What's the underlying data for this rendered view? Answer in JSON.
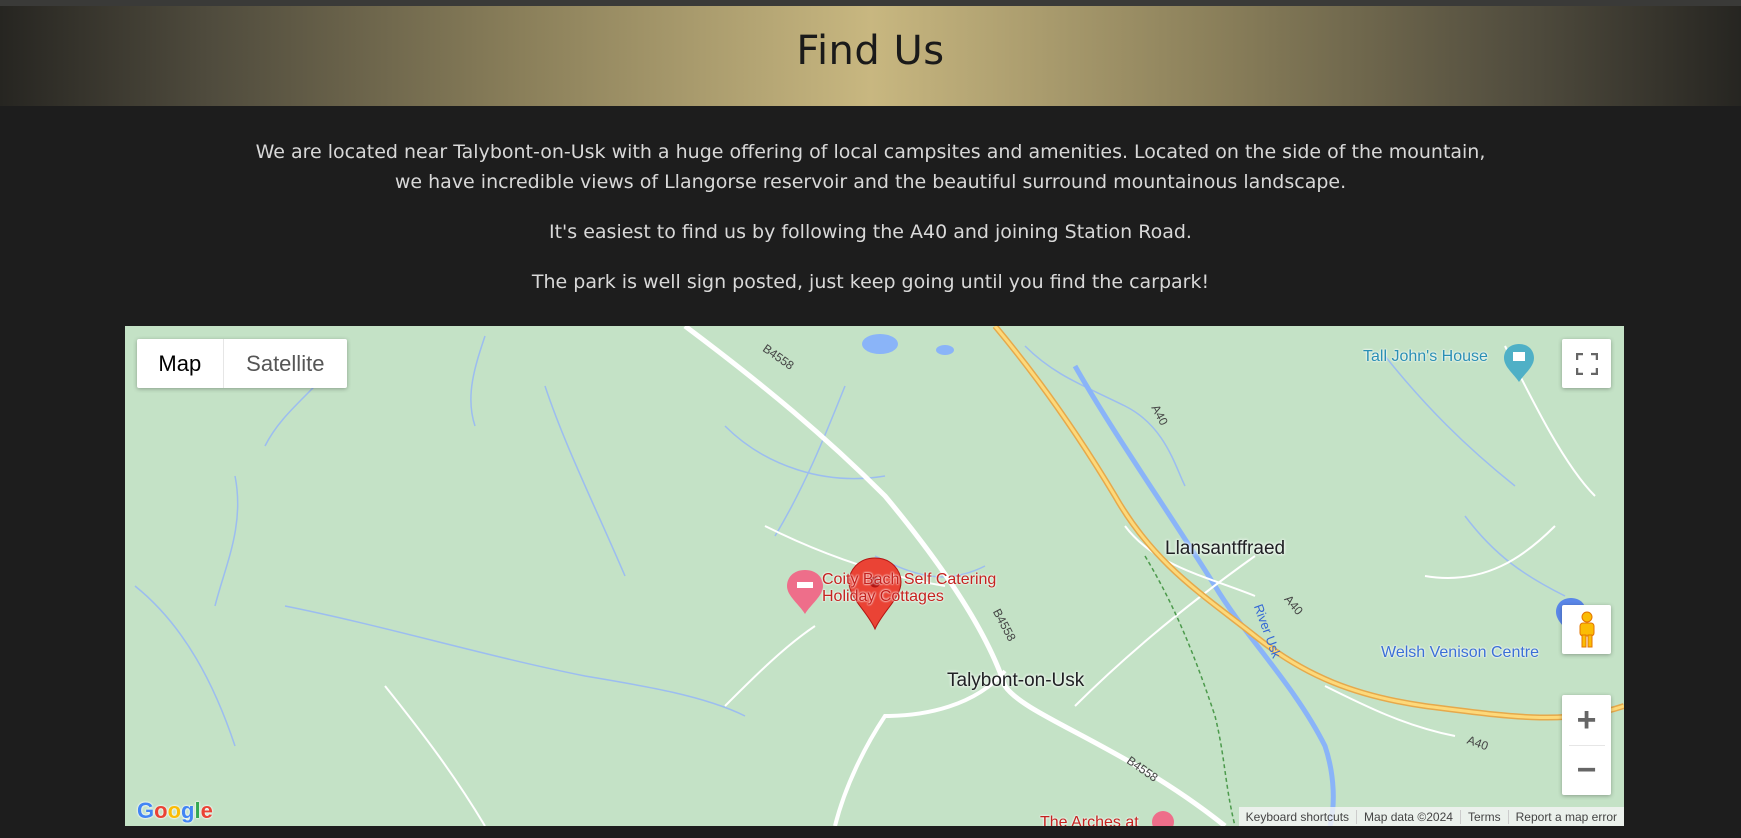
{
  "header": {
    "title": "Find Us"
  },
  "intro": {
    "paragraph_1_line_1": "We are located near Talybont-on-Usk with a huge offering of local campsites and amenities. Located on the side of the mountain,",
    "paragraph_1_line_2": "we have incredible views of Llangorse reservoir and the beautiful surround mountainous landscape.",
    "paragraph_2": "It's easiest to find us by following the A40 and joining Station Road.",
    "paragraph_3": "The park is well sign posted, just keep going until you find the carpark!"
  },
  "map": {
    "type_controls": {
      "map_label": "Map",
      "satellite_label": "Satellite",
      "selected": "Map"
    },
    "places": {
      "poi_marker_line_1": "Coity Bach Self Catering",
      "poi_marker_line_2": "Holiday Cottages",
      "town_1": "Llansantffraed",
      "town_2": "Talybont-on-Usk",
      "poi_top_right": "Tall John's House",
      "poi_right": "Welsh Venison Centre",
      "poi_bottom": "The Arches at",
      "river": "River Usk"
    },
    "roads": {
      "b4558": "B4558",
      "a40": "A40"
    },
    "logo": "Google",
    "attribution": {
      "shortcuts": "Keyboard shortcuts",
      "map_data": "Map data ©2024",
      "terms": "Terms",
      "report": "Report a map error"
    },
    "controls": {
      "fullscreen_icon": "fullscreen-icon",
      "pegman_icon": "pegman-icon",
      "zoom_in": "+",
      "zoom_out": "−"
    },
    "colors": {
      "land": "#c4e2c6",
      "water": "#8ab4f8",
      "major_road": "#f5c46a",
      "marker": "#ea4335"
    }
  }
}
